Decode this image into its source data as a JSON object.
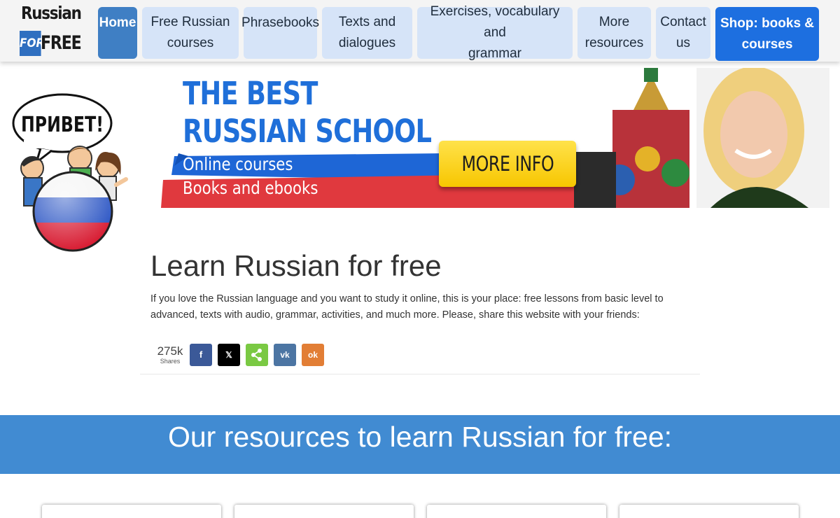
{
  "logo": {
    "line1": "Russian",
    "line2a": "FOR",
    "line2b": "FREE"
  },
  "nav": [
    {
      "lines": [
        "Home"
      ]
    },
    {
      "lines": [
        "Free Russian",
        "courses"
      ]
    },
    {
      "lines": [
        "Phrasebooks"
      ]
    },
    {
      "lines": [
        "Texts and",
        "dialogues"
      ]
    },
    {
      "lines": [
        "Exercises, vocabulary and",
        "grammar"
      ]
    },
    {
      "lines": [
        "More",
        "resources"
      ]
    },
    {
      "lines": [
        "Contact",
        "us"
      ]
    },
    {
      "lines": [
        "Shop: books &",
        "courses"
      ]
    }
  ],
  "mascot": {
    "bubble": "ПРИВЕТ!"
  },
  "banner": {
    "title1": "THE BEST",
    "title2": "RUSSIAN SCHOOL",
    "sub1": "Online courses",
    "sub2": "Books and ebooks",
    "cta": "MORE INFO"
  },
  "main": {
    "heading": "Learn Russian for free",
    "intro": "If you love the Russian language and you want to study it online, this is your place: free lessons from basic level to advanced, texts with audio, grammar, activities, and much more. Please, share this website with your friends:"
  },
  "share": {
    "count": "275k",
    "count_label": "Shares",
    "buttons": [
      {
        "icon": "facebook-icon",
        "glyph": "f",
        "color": "#3b5998"
      },
      {
        "icon": "x-icon",
        "glyph": "𝕏",
        "color": "#000000"
      },
      {
        "icon": "share-icon",
        "glyph": "<",
        "color": "#7ac943"
      },
      {
        "icon": "vk-icon",
        "glyph": "vk",
        "color": "#4c75a3"
      },
      {
        "icon": "odnoklassniki-icon",
        "glyph": "ok",
        "color": "#e27e35"
      }
    ]
  },
  "resources": {
    "heading": "Our resources to learn Russian for free:"
  },
  "colors": {
    "accent": "#418bd2",
    "nav_active": "#3f7fc4",
    "shop": "#1d6fe0",
    "banner_blue": "#1f6fd9",
    "banner_red": "#e0393e"
  }
}
